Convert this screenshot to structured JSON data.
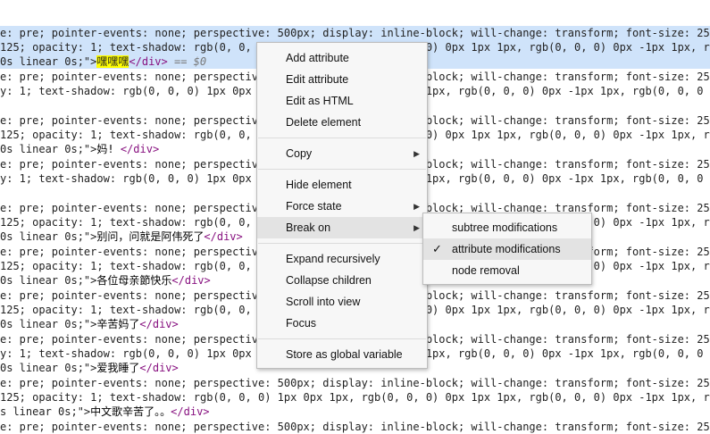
{
  "code_lines": [
    {
      "parts": [
        {
          "c": "attr",
          "t": "e: pre; pointer-events: none; perspective: 500px; display: inline-block; will-change: transform; font-size: 25"
        }
      ]
    },
    {
      "parts": [
        {
          "c": "attr",
          "t": "125; opacity: 1; text-shadow: rgb(0, 0, 0) 1px 0px 1px, rgb(0, 0, 0) 0px 1px 1px, rgb(0, 0, 0) 0px -1px 1px, r"
        }
      ]
    },
    {
      "parts": [
        {
          "c": "attr",
          "t": "0s linear 0s;\">"
        },
        {
          "c": "hl",
          "t": "嘿嘿嘿"
        },
        {
          "c": "tag",
          "t": "</div>"
        },
        {
          "c": "eq",
          "t": " == $0"
        }
      ]
    },
    {
      "parts": [
        {
          "c": "attr",
          "t": "e: pre; pointer-events: none; perspective: 500px; display: inline-block; will-change: transform; font-size: 25"
        }
      ]
    },
    {
      "parts": [
        {
          "c": "attr",
          "t": "y: 1; text-shadow: rgb(0, 0, 0) 1px 0px 1px, rgb(0, 0, 0) 0px 1px 1px, rgb(0, 0, 0) 0px -1px 1px, rgb(0, 0, 0"
        }
      ]
    },
    {
      "parts": [
        {
          "c": "attr",
          "t": ""
        }
      ]
    },
    {
      "parts": [
        {
          "c": "attr",
          "t": "e: pre; pointer-events: none; perspective: 500px; display: inline-block; will-change: transform; font-size: 25"
        }
      ]
    },
    {
      "parts": [
        {
          "c": "attr",
          "t": "125; opacity: 1; text-shadow: rgb(0, 0, 0) 1px 0px 1px, rgb(0, 0, 0) 0px 1px 1px, rgb(0, 0, 0) 0px -1px 1px, r"
        }
      ]
    },
    {
      "parts": [
        {
          "c": "attr",
          "t": "0s linear 0s;\">"
        },
        {
          "c": "txt",
          "t": "妈! "
        },
        {
          "c": "tag",
          "t": "</div>"
        }
      ]
    },
    {
      "parts": [
        {
          "c": "attr",
          "t": "e: pre; pointer-events: none; perspective: 500px; display: inline-block; will-change: transform; font-size: 25"
        }
      ]
    },
    {
      "parts": [
        {
          "c": "attr",
          "t": "y: 1; text-shadow: rgb(0, 0, 0) 1px 0px 1px, rgb(0, 0, 0) 0px 1px 1px, rgb(0, 0, 0) 0px -1px 1px, rgb(0, 0, 0"
        }
      ]
    },
    {
      "parts": [
        {
          "c": "attr",
          "t": ""
        }
      ]
    },
    {
      "parts": [
        {
          "c": "attr",
          "t": "e: pre; pointer-events: none; perspective: 500px; display: inline-block; will-change: transform; font-size: 25"
        }
      ]
    },
    {
      "parts": [
        {
          "c": "attr",
          "t": "125; opacity: 1; text-shadow: rgb(0, 0, 0) 1px 0px 1px, rgb(0, 0, 0) 0px 1px 1px, rgb(0, 0, 0) 0px -1px 1px, r"
        }
      ]
    },
    {
      "parts": [
        {
          "c": "attr",
          "t": "0s linear 0s;\">"
        },
        {
          "c": "txt",
          "t": "别问，问就是阿伟死了"
        },
        {
          "c": "tag",
          "t": "</div>"
        }
      ]
    },
    {
      "parts": [
        {
          "c": "attr",
          "t": "e: pre; pointer-events: none; perspective: 500px; display: inline-block; will-change: transform; font-size: 25"
        }
      ]
    },
    {
      "parts": [
        {
          "c": "attr",
          "t": "125; opacity: 1; text-shadow: rgb(0, 0, 0) 1px 0px 1px, rgb(0, 0, 0) 0px 1px 1px, rgb(0, 0, 0) 0px -1px 1px, r"
        }
      ]
    },
    {
      "parts": [
        {
          "c": "attr",
          "t": "0s linear 0s;\">"
        },
        {
          "c": "txt",
          "t": "各位母亲節快乐"
        },
        {
          "c": "tag",
          "t": "</div>"
        }
      ]
    },
    {
      "parts": [
        {
          "c": "attr",
          "t": "e: pre; pointer-events: none; perspective: 500px; display: inline-block; will-change: transform; font-size: 25"
        }
      ]
    },
    {
      "parts": [
        {
          "c": "attr",
          "t": "125; opacity: 1; text-shadow: rgb(0, 0, 0) 1px 0px 1px, rgb(0, 0, 0) 0px 1px 1px, rgb(0, 0, 0) 0px -1px 1px, r"
        }
      ]
    },
    {
      "parts": [
        {
          "c": "attr",
          "t": "0s linear 0s;\">"
        },
        {
          "c": "txt",
          "t": "辛苦妈了"
        },
        {
          "c": "tag",
          "t": "</div>"
        }
      ]
    },
    {
      "parts": [
        {
          "c": "attr",
          "t": "e: pre; pointer-events: none; perspective: 500px; display: inline-block; will-change: transform; font-size: 25"
        }
      ]
    },
    {
      "parts": [
        {
          "c": "attr",
          "t": "y: 1; text-shadow: rgb(0, 0, 0) 1px 0px 1px, rgb(0, 0, 0) 0px 1px 1px, rgb(0, 0, 0) 0px -1px 1px, rgb(0, 0, 0"
        }
      ]
    },
    {
      "parts": [
        {
          "c": "attr",
          "t": "0s linear 0s;\">"
        },
        {
          "c": "txt",
          "t": "爱我睡了"
        },
        {
          "c": "tag",
          "t": "</div>"
        }
      ]
    },
    {
      "parts": [
        {
          "c": "attr",
          "t": "e: pre; pointer-events: none; perspective: 500px; display: inline-block; will-change: transform; font-size: 25"
        }
      ]
    },
    {
      "parts": [
        {
          "c": "attr",
          "t": "125; opacity: 1; text-shadow: rgb(0, 0, 0) 1px 0px 1px, rgb(0, 0, 0) 0px 1px 1px, rgb(0, 0, 0) 0px -1px 1px, r"
        }
      ]
    },
    {
      "parts": [
        {
          "c": "attr",
          "t": "s linear 0s;\">"
        },
        {
          "c": "txt",
          "t": "中文歌辛苦了。。"
        },
        {
          "c": "tag",
          "t": "</div>"
        }
      ]
    },
    {
      "parts": [
        {
          "c": "attr",
          "t": "e: pre; pointer-events: none; perspective: 500px; display: inline-block; will-change: transform; font-size: 25"
        }
      ]
    }
  ],
  "context_menu": {
    "items": [
      {
        "label": "Add attribute",
        "name": "menu-add-attribute"
      },
      {
        "label": "Edit attribute",
        "name": "menu-edit-attribute"
      },
      {
        "label": "Edit as HTML",
        "name": "menu-edit-as-html"
      },
      {
        "label": "Delete element",
        "name": "menu-delete-element"
      },
      {
        "sep": true
      },
      {
        "label": "Copy",
        "name": "menu-copy",
        "submenu": true
      },
      {
        "sep": true
      },
      {
        "label": "Hide element",
        "name": "menu-hide-element"
      },
      {
        "label": "Force state",
        "name": "menu-force-state",
        "submenu": true
      },
      {
        "label": "Break on",
        "name": "menu-break-on",
        "submenu": true,
        "hover": true
      },
      {
        "sep": true
      },
      {
        "label": "Expand recursively",
        "name": "menu-expand-recursively"
      },
      {
        "label": "Collapse children",
        "name": "menu-collapse-children"
      },
      {
        "label": "Scroll into view",
        "name": "menu-scroll-into-view"
      },
      {
        "label": "Focus",
        "name": "menu-focus"
      },
      {
        "sep": true
      },
      {
        "label": "Store as global variable",
        "name": "menu-store-as-global-variable"
      }
    ]
  },
  "break_on_submenu": {
    "items": [
      {
        "label": "subtree modifications",
        "name": "submenu-subtree-modifications",
        "checked": false
      },
      {
        "label": "attribute modifications",
        "name": "submenu-attribute-modifications",
        "checked": true,
        "hover": true
      },
      {
        "label": "node removal",
        "name": "submenu-node-removal",
        "checked": false
      }
    ]
  },
  "icons": {
    "check": "✓",
    "arrow": "▶"
  }
}
